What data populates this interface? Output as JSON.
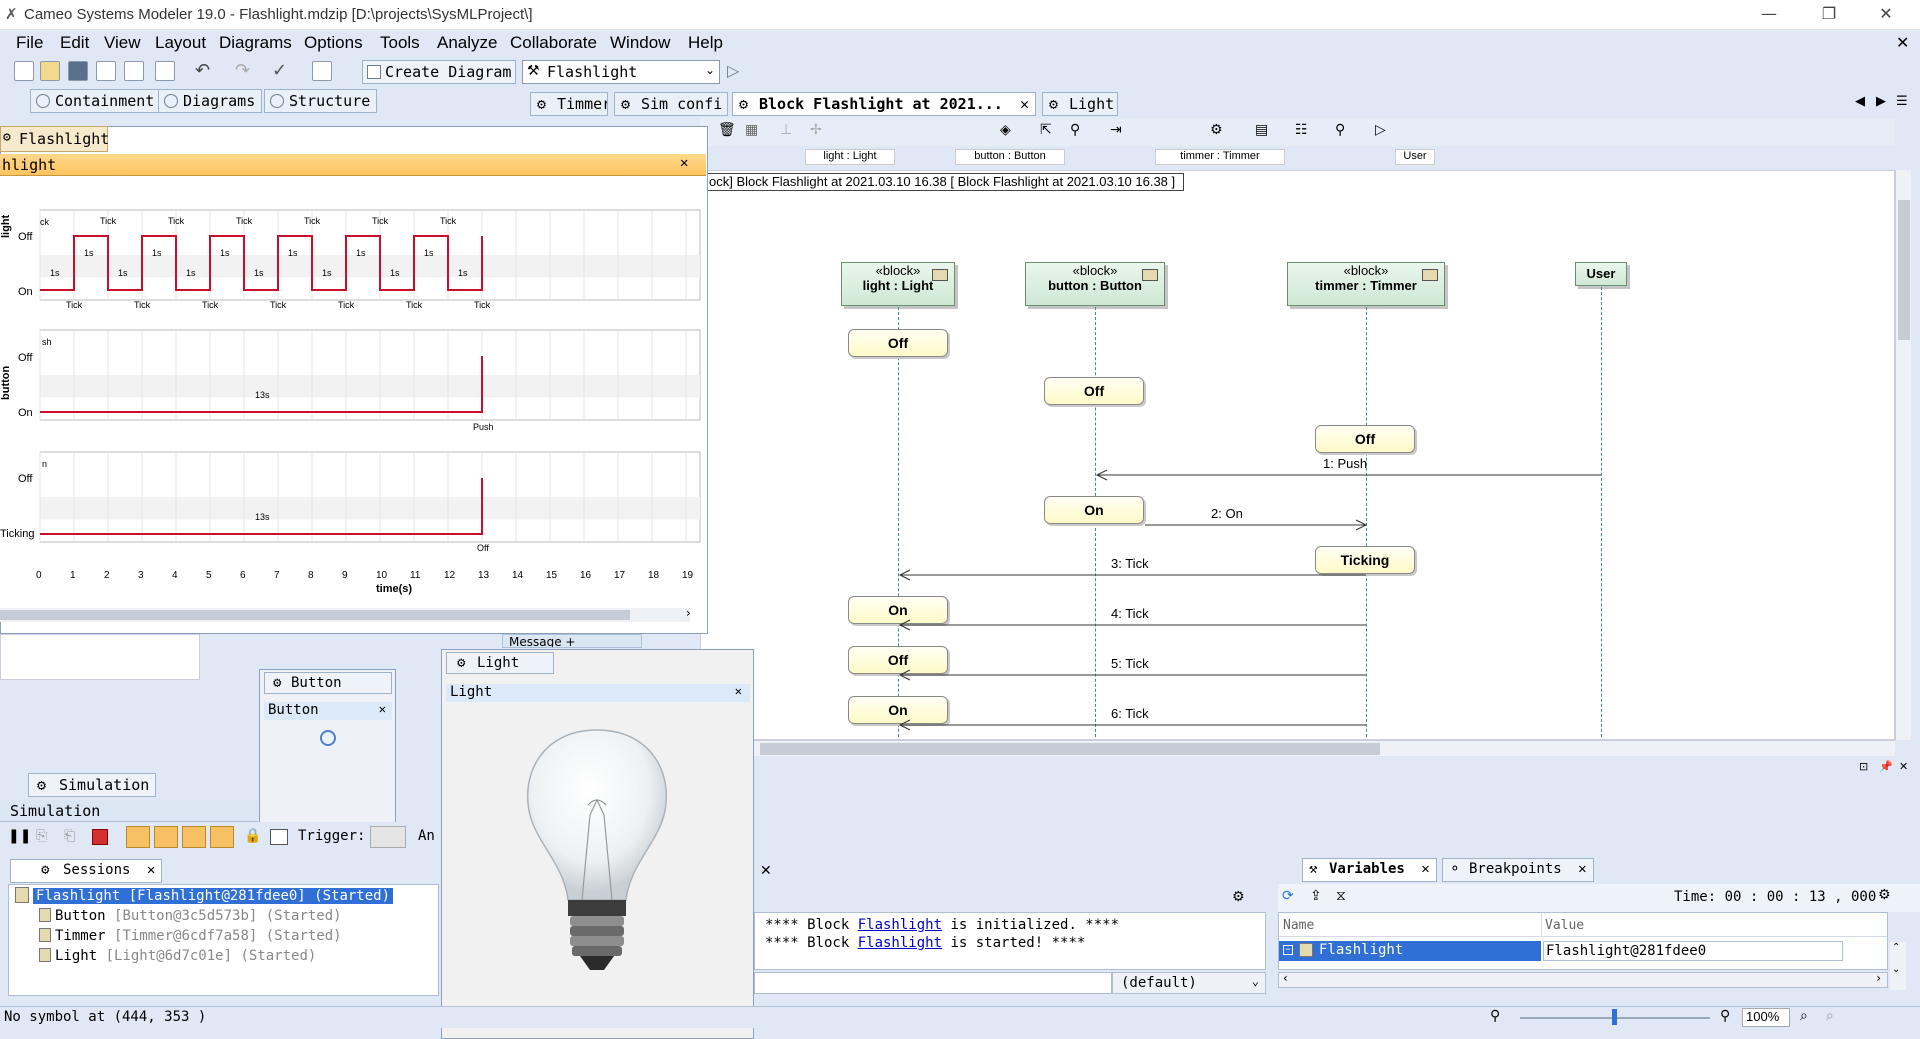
{
  "window": {
    "title": "Cameo Systems Modeler 19.0 - Flashlight.mdzip [D:\\projects\\SysMLProject\\]"
  },
  "menu": [
    "File",
    "Edit",
    "View",
    "Layout",
    "Diagrams",
    "Options",
    "Tools",
    "Analyze",
    "Collaborate",
    "Window",
    "Help"
  ],
  "toolbar": {
    "create_diagram": "Create Diagram",
    "context_select": "Flashlight"
  },
  "left_tabs": [
    "Containment",
    "Diagrams",
    "Structure"
  ],
  "diagram_tabs": [
    {
      "label": "Timmer"
    },
    {
      "label": "Sim confi"
    },
    {
      "label": "Block Flashlight at 2021..."
    },
    {
      "label": "Light"
    }
  ],
  "column_headers": [
    "light : Light",
    "button : Button",
    "timmer : Timmer",
    "User"
  ],
  "diagram": {
    "frame_label": "ock] Block Flashlight at 2021.03.10 16.38 [ Block Flashlight at 2021.03.10 16.38 ]",
    "lifelines": [
      {
        "stereo": "«block»",
        "name": "light : Light"
      },
      {
        "stereo": "«block»",
        "name": "button : Button"
      },
      {
        "stereo": "«block»",
        "name": "timmer : Timmer"
      },
      {
        "stereo": "",
        "name": "User"
      }
    ],
    "states": {
      "light_1": "Off",
      "button_1": "Off",
      "timmer_1": "Off",
      "button_2": "On",
      "timmer_2": "Ticking",
      "light_2": "On",
      "light_3": "Off",
      "light_4": "On"
    },
    "messages": [
      "1: Push",
      "2: On",
      "3: Tick",
      "4: Tick",
      "5: Tick",
      "6: Tick"
    ]
  },
  "timing": {
    "tab_label": "Flashlight",
    "header": "hlight",
    "rows": [
      {
        "lifeline": "light",
        "states": [
          "Off",
          "On"
        ]
      },
      {
        "lifeline": "button",
        "states": [
          "Off",
          "On"
        ]
      },
      {
        "lifeline": "",
        "states": [
          "Off",
          "Ticking"
        ]
      }
    ],
    "tick_label": "Tick",
    "pulse_label": "1s",
    "button_duration": "13s",
    "button_event": "Push",
    "timmer_duration": "13s",
    "timmer_event": "Off",
    "partial_label_1": "ck",
    "partial_label_2": "sh",
    "partial_label_3": "n",
    "axis_ticks": [
      "0",
      "1",
      "2",
      "3",
      "4",
      "5",
      "6",
      "7",
      "8",
      "9",
      "10",
      "11",
      "12",
      "13",
      "14",
      "15",
      "16",
      "17",
      "18",
      "19"
    ],
    "xlabel": "time(s)"
  },
  "button_window": {
    "tab": "Button",
    "title": "Button"
  },
  "light_window": {
    "tab": "Light",
    "title": "Light"
  },
  "simulation": {
    "tab": "Simulation",
    "header": "Simulation",
    "trigger_label": "Trigger:",
    "an_label": "An",
    "sessions_tab": "Sessions",
    "sessions": [
      {
        "name": "Flashlight",
        "detail": "[Flashlight@281fdee0] (Started)"
      },
      {
        "name": "Button",
        "detail": "[Button@3c5d573b] (Started)"
      },
      {
        "name": "Timmer",
        "detail": "[Timmer@6cdf7a58] (Started)"
      },
      {
        "name": "Light",
        "detail": "[Light@6d7c01e] (Started)"
      }
    ]
  },
  "console": {
    "line1_pre": "**** Block ",
    "line1_link": "Flashlight",
    "line1_post": " is initialized. ****",
    "line2_pre": "**** Block ",
    "line2_link": "Flashlight",
    "line2_post": " is started! ****",
    "default_select": "(default)"
  },
  "variables": {
    "tab": "Variables",
    "breakpoints_tab": "Breakpoints",
    "time": "Time: 00 : 00 : 13 , 000",
    "col_name": "Name",
    "col_value": "Value",
    "row_name": "Flashlight",
    "row_value": "Flashlight@281fdee0"
  },
  "status": {
    "text": "No symbol at (444, 353 )",
    "zoom": "100%"
  },
  "partial_tab": "Message +"
}
